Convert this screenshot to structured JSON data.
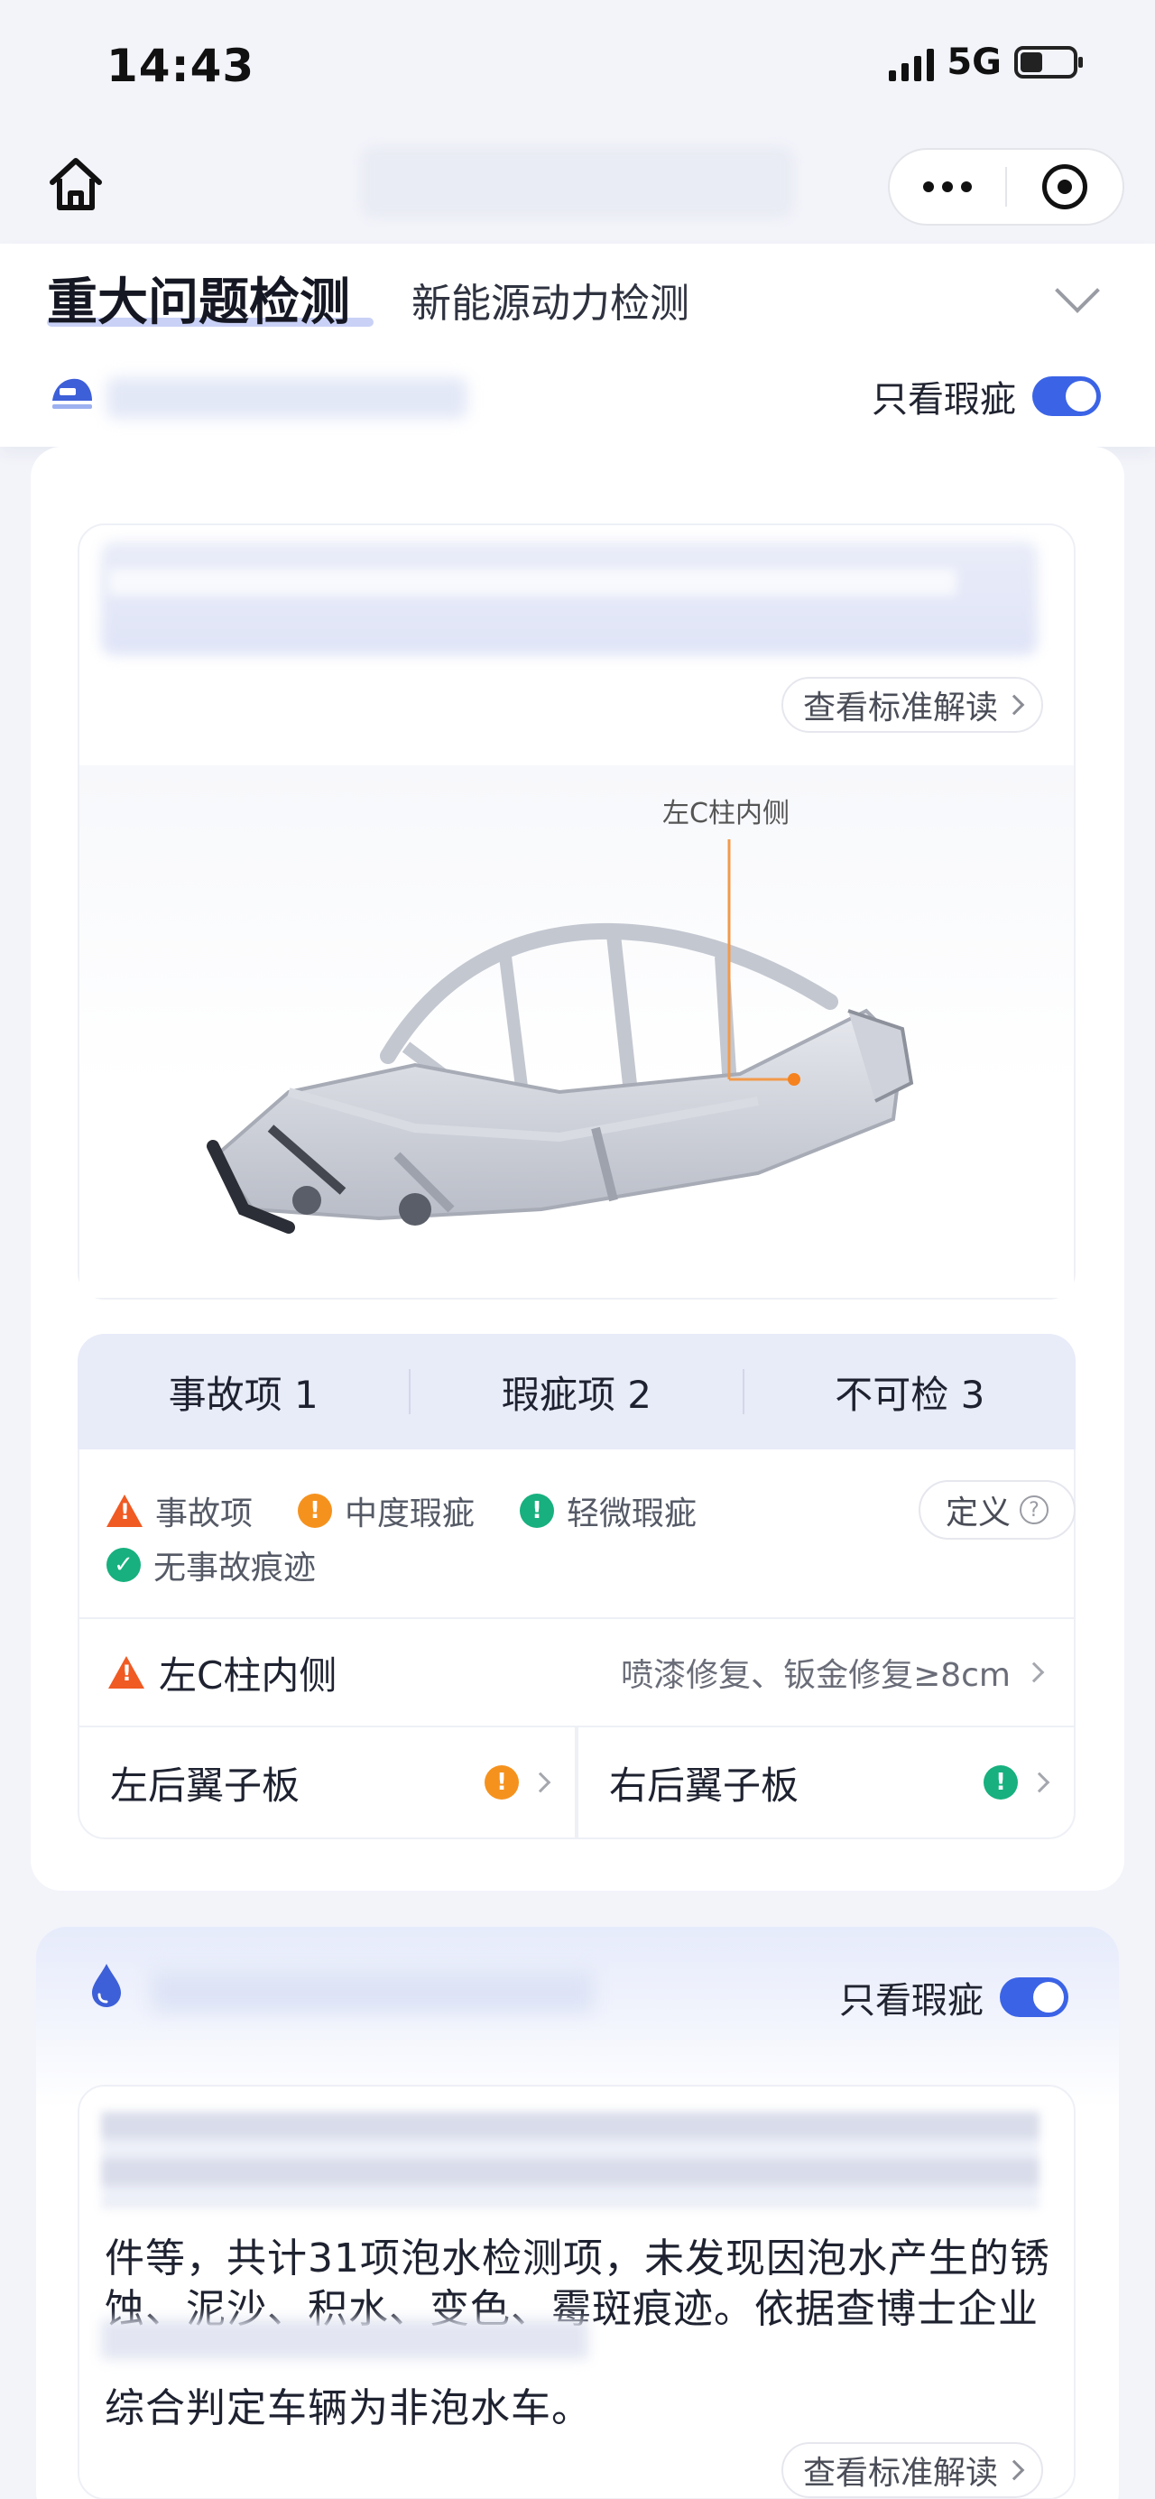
{
  "status_bar": {
    "time": "14:43",
    "network": "5G"
  },
  "nav": {
    "title_redacted": true
  },
  "header": {
    "tab_active": "重大问题检测",
    "tab_inactive": "新能源动力检测",
    "toggle_label": "只看瑕疵",
    "toggle_on": true
  },
  "accident_card": {
    "standard_button": "查看标准解读",
    "car_point_label": "左C柱内侧",
    "stats": [
      {
        "label": "事故项 1"
      },
      {
        "label": "瑕疵项 2"
      },
      {
        "label": "不可检 3"
      }
    ],
    "legend": [
      {
        "label": "事故项",
        "icon": "accident-triangle-icon",
        "color": "#f05a23"
      },
      {
        "label": "中度瑕疵",
        "icon": "moderate-flaw-icon",
        "color": "#f5921e"
      },
      {
        "label": "轻微瑕疵",
        "icon": "minor-flaw-icon",
        "color": "#17b07e"
      },
      {
        "label": "无事故痕迹",
        "icon": "no-accident-check-icon",
        "color": "#17b07e"
      }
    ],
    "define_button": "定义",
    "items": {
      "accident_row": {
        "title": "左C柱内侧",
        "detail": "喷漆修复、钣金修复≥8cm"
      },
      "left_fender": {
        "title": "左后翼子板",
        "severity": "moderate"
      },
      "right_fender": {
        "title": "右后翼子板",
        "severity": "minor"
      }
    }
  },
  "flood_section": {
    "toggle_label": "只看瑕疵",
    "toggle_on": true,
    "para_line_1": "件等，共计31项泡水检测项，未发现因泡水产生的锈",
    "para_line_2": "蚀、泥沙、积水、变色、霉斑痕迹。依据查博士企业",
    "para_line_3": "综合判定车辆为非泡水车。",
    "standard_button": "查看标准解读"
  }
}
